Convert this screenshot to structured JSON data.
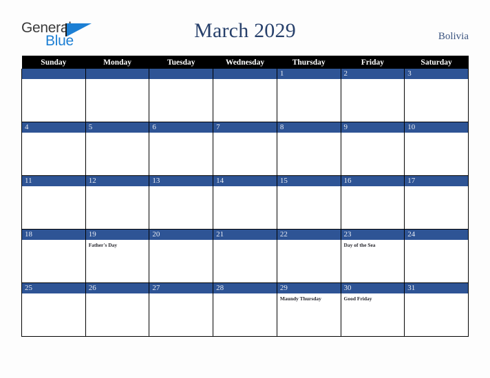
{
  "logo": {
    "word_one": "General",
    "word_two": "Blue",
    "triangle_icon": "triangle-icon",
    "colors": {
      "general_text": "#3a3a3a",
      "blue_text": "#1c7fd4",
      "triangle": "#1c7fd4"
    }
  },
  "header": {
    "title": "March 2029",
    "country": "Bolivia",
    "title_color": "#27406b",
    "country_color": "#3c5580"
  },
  "calendar": {
    "weekday_headers": [
      "Sunday",
      "Monday",
      "Tuesday",
      "Wednesday",
      "Thursday",
      "Friday",
      "Saturday"
    ],
    "header_bg": "#000000",
    "header_text": "#ffffff",
    "daynum_bg": "#2e5495",
    "daynum_text": "#e8ecf4",
    "cell_bg": "#ffffff",
    "border_color": "#000000",
    "weeks": [
      [
        {
          "day": "",
          "events": []
        },
        {
          "day": "",
          "events": []
        },
        {
          "day": "",
          "events": []
        },
        {
          "day": "",
          "events": []
        },
        {
          "day": "1",
          "events": []
        },
        {
          "day": "2",
          "events": []
        },
        {
          "day": "3",
          "events": []
        }
      ],
      [
        {
          "day": "4",
          "events": []
        },
        {
          "day": "5",
          "events": []
        },
        {
          "day": "6",
          "events": []
        },
        {
          "day": "7",
          "events": []
        },
        {
          "day": "8",
          "events": []
        },
        {
          "day": "9",
          "events": []
        },
        {
          "day": "10",
          "events": []
        }
      ],
      [
        {
          "day": "11",
          "events": []
        },
        {
          "day": "12",
          "events": []
        },
        {
          "day": "13",
          "events": []
        },
        {
          "day": "14",
          "events": []
        },
        {
          "day": "15",
          "events": []
        },
        {
          "day": "16",
          "events": []
        },
        {
          "day": "17",
          "events": []
        }
      ],
      [
        {
          "day": "18",
          "events": []
        },
        {
          "day": "19",
          "events": [
            "Father's Day"
          ]
        },
        {
          "day": "20",
          "events": []
        },
        {
          "day": "21",
          "events": []
        },
        {
          "day": "22",
          "events": []
        },
        {
          "day": "23",
          "events": [
            "Day of the Sea"
          ]
        },
        {
          "day": "24",
          "events": []
        }
      ],
      [
        {
          "day": "25",
          "events": []
        },
        {
          "day": "26",
          "events": []
        },
        {
          "day": "27",
          "events": []
        },
        {
          "day": "28",
          "events": []
        },
        {
          "day": "29",
          "events": [
            "Maundy Thursday"
          ]
        },
        {
          "day": "30",
          "events": [
            "Good Friday"
          ]
        },
        {
          "day": "31",
          "events": []
        }
      ]
    ]
  }
}
